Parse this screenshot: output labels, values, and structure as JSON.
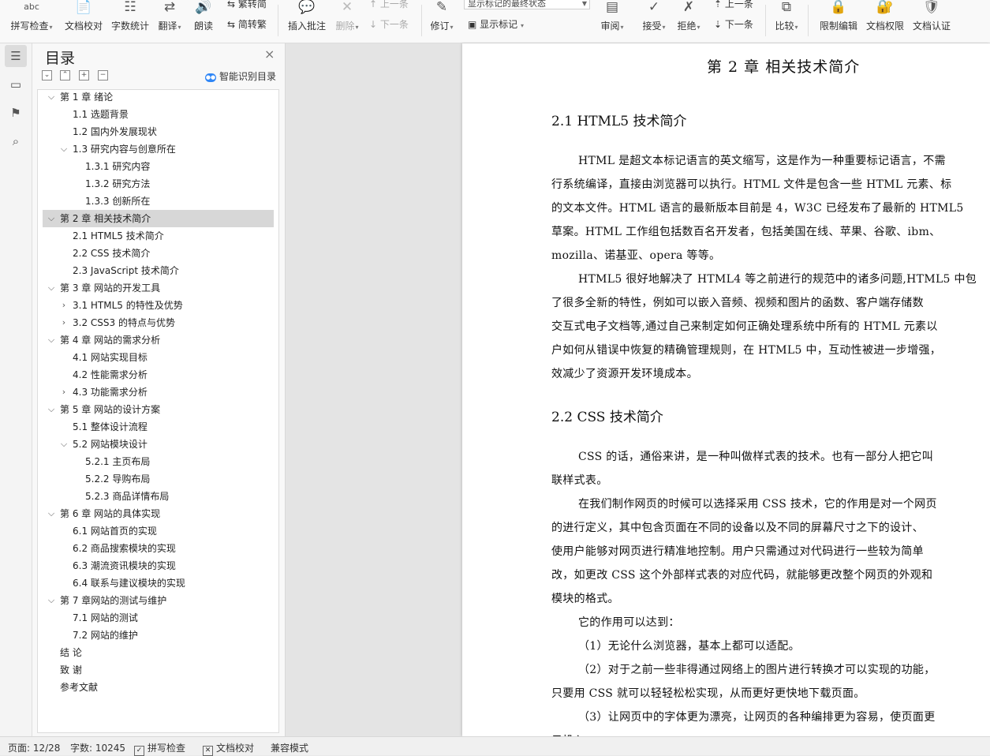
{
  "ribbon": {
    "items": [
      {
        "name": "spell-check-button",
        "icon": "abc",
        "label": "拼写检查",
        "dropdown": true
      },
      {
        "name": "doc-proofread-button",
        "icon": "📄",
        "label": "文档校对",
        "dropdown": false
      },
      {
        "name": "word-count-button",
        "icon": "☷",
        "label": "字数统计",
        "dropdown": false
      },
      {
        "name": "translate-button",
        "icon": "⇄",
        "label": "翻译",
        "dropdown": true
      },
      {
        "name": "read-aloud-button",
        "icon": "🔊",
        "label": "朗读",
        "dropdown": false
      },
      {
        "name": "insert-comment-button",
        "icon": "💬",
        "label": "插入批注",
        "dropdown": false
      },
      {
        "name": "delete-comment-button",
        "icon": "✕",
        "label": "删除",
        "dropdown": true
      },
      {
        "name": "track-changes-button",
        "icon": "✎",
        "label": "修订",
        "dropdown": true
      },
      {
        "name": "review-button",
        "icon": "▤",
        "label": "审阅",
        "dropdown": true
      },
      {
        "name": "accept-button",
        "icon": "✓",
        "label": "接受",
        "dropdown": true
      },
      {
        "name": "reject-button",
        "icon": "✗",
        "label": "拒绝",
        "dropdown": true
      },
      {
        "name": "compare-button",
        "icon": "⧉",
        "label": "比较",
        "dropdown": true
      },
      {
        "name": "restrict-edit-button",
        "icon": "🔒",
        "label": "限制编辑",
        "dropdown": false
      },
      {
        "name": "doc-permission-button",
        "icon": "🔐",
        "label": "文档权限",
        "dropdown": false
      },
      {
        "name": "doc-certify-button",
        "icon": "🛡",
        "label": "文档认证",
        "dropdown": false
      }
    ],
    "trad_to_simp": "繁转简",
    "simp_to_trad": "简转繁",
    "prev_comment": "上一条",
    "next_comment": "下一条",
    "markup_state": "显示标记的最终状态",
    "show_markup": "显示标记",
    "prev_change": "上一条",
    "next_change": "下一条"
  },
  "toc": {
    "title": "目录",
    "ai_label": "智能识别目录",
    "items": [
      {
        "level": 1,
        "text": "第 1 章  绪论",
        "expanded": true
      },
      {
        "level": 2,
        "text": "1.1  选题背景"
      },
      {
        "level": 2,
        "text": "1.2  国内外发展现状"
      },
      {
        "level": 2,
        "text": "1.3  研究内容与创意所在",
        "expanded": true
      },
      {
        "level": 3,
        "text": "1.3.1  研究内容"
      },
      {
        "level": 3,
        "text": "1.3.2  研究方法"
      },
      {
        "level": 3,
        "text": "1.3.3  创新所在"
      },
      {
        "level": 1,
        "text": "第 2 章  相关技术简介",
        "expanded": true,
        "selected": true
      },
      {
        "level": 2,
        "text": "2.1 HTML5 技术简介"
      },
      {
        "level": 2,
        "text": "2.2 CSS 技术简介"
      },
      {
        "level": 2,
        "text": "2.3 JavaScript 技术简介"
      },
      {
        "level": 1,
        "text": "第 3 章  网站的开发工具",
        "expanded": true
      },
      {
        "level": 2,
        "text": "3.1 HTML5 的特性及优势",
        "collapsed": true
      },
      {
        "level": 2,
        "text": "3.2 CSS3 的特点与优势",
        "collapsed": true
      },
      {
        "level": 1,
        "text": "第 4 章  网站的需求分析",
        "expanded": true
      },
      {
        "level": 2,
        "text": "4.1  网站实现目标"
      },
      {
        "level": 2,
        "text": "4.2  性能需求分析"
      },
      {
        "level": 2,
        "text": "4.3  功能需求分析",
        "collapsed": true
      },
      {
        "level": 1,
        "text": "第 5 章  网站的设计方案",
        "expanded": true
      },
      {
        "level": 2,
        "text": "5.1  整体设计流程"
      },
      {
        "level": 2,
        "text": "5.2  网站模块设计",
        "expanded": true
      },
      {
        "level": 3,
        "text": "5.2.1  主页布局"
      },
      {
        "level": 3,
        "text": "5.2.2  导购布局"
      },
      {
        "level": 3,
        "text": "5.2.3  商品详情布局"
      },
      {
        "level": 1,
        "text": "第 6 章  网站的具体实现",
        "expanded": true
      },
      {
        "level": 2,
        "text": "6.1  网站首页的实现"
      },
      {
        "level": 2,
        "text": "6.2  商品搜索模块的实现"
      },
      {
        "level": 2,
        "text": "6.3  潮流资讯模块的实现"
      },
      {
        "level": 2,
        "text": "6.4  联系与建议模块的实现"
      },
      {
        "level": 1,
        "text": "第 7 章网站的测试与维护",
        "expanded": true
      },
      {
        "level": 2,
        "text": "7.1  网站的测试"
      },
      {
        "level": 2,
        "text": "7.2  网站的维护"
      },
      {
        "level": 1,
        "text": "结    论"
      },
      {
        "level": 1,
        "text": "致    谢"
      },
      {
        "level": 1,
        "text": "参考文献"
      }
    ]
  },
  "document": {
    "chapter_title": "第 2 章  相关技术简介",
    "sec1_title": "2.1 HTML5 技术简介",
    "sec2_title": "2.2 CSS 技术简介",
    "lines": [
      {
        "text": "HTML 是超文本标记语言的英文缩写，这是作为一种重要标记语言，不需",
        "indent": true
      },
      {
        "text": "行系统编译，直接由浏览器可以执行。HTML 文件是包含一些 HTML 元素、标",
        "indent": false
      },
      {
        "text": "的文本文件。HTML 语言的最新版本目前是 4，W3C 已经发布了最新的 HTML5",
        "indent": false
      },
      {
        "text": "草案。HTML 工作组包括数百名开发者，包括美国在线、苹果、谷歌、ibm、",
        "indent": false
      },
      {
        "text": "mozilla、诺基亚、opera 等等。",
        "indent": false
      },
      {
        "text": "HTML5 很好地解决了 HTML4 等之前进行的规范中的诸多问题,HTML5 中包",
        "indent": true
      },
      {
        "text": "了很多全新的特性，例如可以嵌入音频、视频和图片的函数、客户端存储数",
        "indent": false
      },
      {
        "text": "交互式电子文档等,通过自己来制定如何正确处理系统中所有的 HTML 元素以",
        "indent": false
      },
      {
        "text": "户如何从错误中恢复的精确管理规则，在 HTML5 中，互动性被进一步增强，",
        "indent": false
      },
      {
        "text": "效减少了资源开发环境成本。",
        "indent": false
      },
      {
        "text": "CSS 的话，通俗来讲，是一种叫做样式表的技术。也有一部分人把它叫",
        "indent": true
      },
      {
        "text": "联样式表。",
        "indent": false
      },
      {
        "text": "在我们制作网页的时候可以选择采用 CSS 技术，它的作用是对一个网页",
        "indent": true
      },
      {
        "text": "的进行定义，其中包含页面在不同的设备以及不同的屏幕尺寸之下的设计、",
        "indent": false
      },
      {
        "text": "使用户能够对网页进行精准地控制。用户只需通过对代码进行一些较为简单",
        "indent": false
      },
      {
        "text": "改，如更改 CSS 这个外部样式表的对应代码，就能够更改整个网页的外观和",
        "indent": false
      },
      {
        "text": "模块的格式。",
        "indent": false
      },
      {
        "text": "它的作用可以达到：",
        "indent": true
      },
      {
        "text": "（1）无论什么浏览器，基本上都可以适配。",
        "indent": true
      },
      {
        "text": "（2）对于之前一些非得通过网络上的图片进行转换才可以实现的功能，",
        "indent": true
      },
      {
        "text": "只要用 CSS 就可以轻轻松松实现，从而更好更快地下载页面。",
        "indent": false
      },
      {
        "text": "（3）让网页中的字体更为漂亮，让网页的各种编排更为容易，使页面更",
        "indent": true
      },
      {
        "text": "目投入",
        "indent": false
      }
    ]
  },
  "status": {
    "page": "页面: 12/28",
    "words": "字数: 10245",
    "spell": "拼写检查",
    "proof": "文档校对",
    "compat": "兼容模式"
  }
}
